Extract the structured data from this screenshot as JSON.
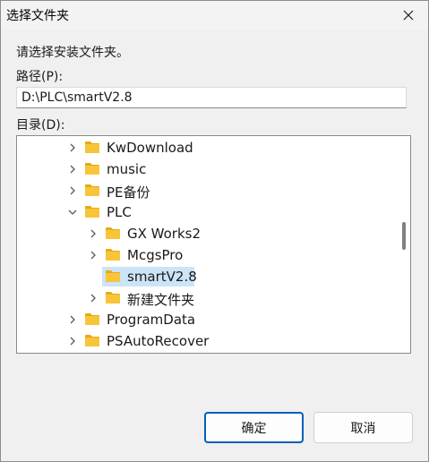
{
  "window": {
    "title": "选择文件夹",
    "close_icon": "close-icon"
  },
  "prompt": "请选择安装文件夹。",
  "path": {
    "label": "路径(P):",
    "value": "D:\\PLC\\smartV2.8"
  },
  "directory": {
    "label": "目录(D):"
  },
  "tree": {
    "items": [
      {
        "label": "KwDownload",
        "level": 0,
        "expanded": false,
        "has_children": true,
        "selected": false
      },
      {
        "label": "music",
        "level": 0,
        "expanded": false,
        "has_children": true,
        "selected": false
      },
      {
        "label": "PE备份",
        "level": 0,
        "expanded": false,
        "has_children": true,
        "selected": false
      },
      {
        "label": "PLC",
        "level": 0,
        "expanded": true,
        "has_children": true,
        "selected": false
      },
      {
        "label": "GX Works2",
        "level": 1,
        "expanded": false,
        "has_children": true,
        "selected": false
      },
      {
        "label": "McgsPro",
        "level": 1,
        "expanded": false,
        "has_children": true,
        "selected": false
      },
      {
        "label": "smartV2.8",
        "level": 1,
        "expanded": false,
        "has_children": false,
        "selected": true
      },
      {
        "label": "新建文件夹",
        "level": 1,
        "expanded": false,
        "has_children": true,
        "selected": false
      },
      {
        "label": "ProgramData",
        "level": 0,
        "expanded": false,
        "has_children": true,
        "selected": false
      },
      {
        "label": "PSAutoRecover",
        "level": 0,
        "expanded": false,
        "has_children": true,
        "selected": false
      }
    ]
  },
  "buttons": {
    "ok": "确定",
    "cancel": "取消"
  },
  "colors": {
    "accent": "#005fb8",
    "selection": "#cce4f7",
    "folder": "#f8c53a"
  }
}
